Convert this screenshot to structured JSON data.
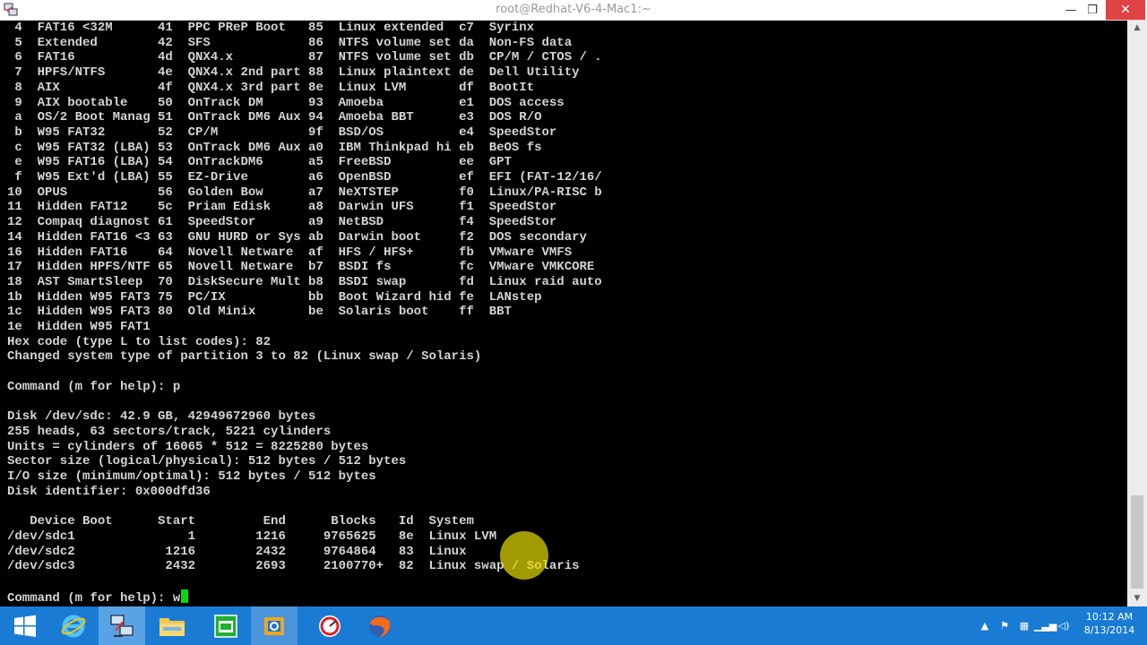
{
  "window": {
    "title": "root@Redhat-V6-4-Mac1:~",
    "minimize": "—",
    "maximize": "❐",
    "close": "✕"
  },
  "terminal": {
    "lines": [
      " 4  FAT16 <32M      41  PPC PReP Boot   85  Linux extended  c7  Syrinx",
      " 5  Extended        42  SFS             86  NTFS volume set da  Non-FS data",
      " 6  FAT16           4d  QNX4.x          87  NTFS volume set db  CP/M / CTOS / .",
      " 7  HPFS/NTFS       4e  QNX4.x 2nd part 88  Linux plaintext de  Dell Utility",
      " 8  AIX             4f  QNX4.x 3rd part 8e  Linux LVM       df  BootIt",
      " 9  AIX bootable    50  OnTrack DM      93  Amoeba          e1  DOS access",
      " a  OS/2 Boot Manag 51  OnTrack DM6 Aux 94  Amoeba BBT      e3  DOS R/O",
      " b  W95 FAT32       52  CP/M            9f  BSD/OS          e4  SpeedStor",
      " c  W95 FAT32 (LBA) 53  OnTrack DM6 Aux a0  IBM Thinkpad hi eb  BeOS fs",
      " e  W95 FAT16 (LBA) 54  OnTrackDM6      a5  FreeBSD         ee  GPT",
      " f  W95 Ext'd (LBA) 55  EZ-Drive        a6  OpenBSD         ef  EFI (FAT-12/16/",
      "10  OPUS            56  Golden Bow      a7  NeXTSTEP        f0  Linux/PA-RISC b",
      "11  Hidden FAT12    5c  Priam Edisk     a8  Darwin UFS      f1  SpeedStor",
      "12  Compaq diagnost 61  SpeedStor       a9  NetBSD          f4  SpeedStor",
      "14  Hidden FAT16 <3 63  GNU HURD or Sys ab  Darwin boot     f2  DOS secondary",
      "16  Hidden FAT16    64  Novell Netware  af  HFS / HFS+      fb  VMware VMFS",
      "17  Hidden HPFS/NTF 65  Novell Netware  b7  BSDI fs         fc  VMware VMKCORE",
      "18  AST SmartSleep  70  DiskSecure Mult b8  BSDI swap       fd  Linux raid auto",
      "1b  Hidden W95 FAT3 75  PC/IX           bb  Boot Wizard hid fe  LANstep",
      "1c  Hidden W95 FAT3 80  Old Minix       be  Solaris boot    ff  BBT",
      "1e  Hidden W95 FAT1",
      "Hex code (type L to list codes): 82",
      "Changed system type of partition 3 to 82 (Linux swap / Solaris)",
      "",
      "Command (m for help): p",
      "",
      "Disk /dev/sdc: 42.9 GB, 42949672960 bytes",
      "255 heads, 63 sectors/track, 5221 cylinders",
      "Units = cylinders of 16065 * 512 = 8225280 bytes",
      "Sector size (logical/physical): 512 bytes / 512 bytes",
      "I/O size (minimum/optimal): 512 bytes / 512 bytes",
      "Disk identifier: 0x000dfd36",
      "",
      "   Device Boot      Start         End      Blocks   Id  System",
      "/dev/sdc1               1        1216     9765625   8e  Linux LVM",
      "/dev/sdc2            1216        2432     9764864   83  Linux",
      "/dev/sdc3            2432        2693     2100770+  82  Linux swap / Solaris",
      "",
      "Command (m for help): w"
    ]
  },
  "taskbar": {
    "items": [
      {
        "name": "start-button",
        "icon": "windows-logo-icon"
      },
      {
        "name": "internet-explorer",
        "icon": "internet-explorer-icon"
      },
      {
        "name": "remote-connection",
        "icon": "network-computers-icon"
      },
      {
        "name": "file-explorer",
        "icon": "folder-icon"
      },
      {
        "name": "task-app",
        "icon": "green-window-icon"
      },
      {
        "name": "outlook",
        "icon": "outlook-icon"
      },
      {
        "name": "speedometer-app",
        "icon": "gauge-icon"
      },
      {
        "name": "firefox",
        "icon": "firefox-icon"
      }
    ],
    "clock_time": "10:12 AM",
    "clock_date": "8/13/2014"
  },
  "colors": {
    "terminal_text": "#d4d4d4",
    "cursor": "#00e000",
    "taskbar": "#1a7bd4",
    "close_button": "#e04343"
  }
}
